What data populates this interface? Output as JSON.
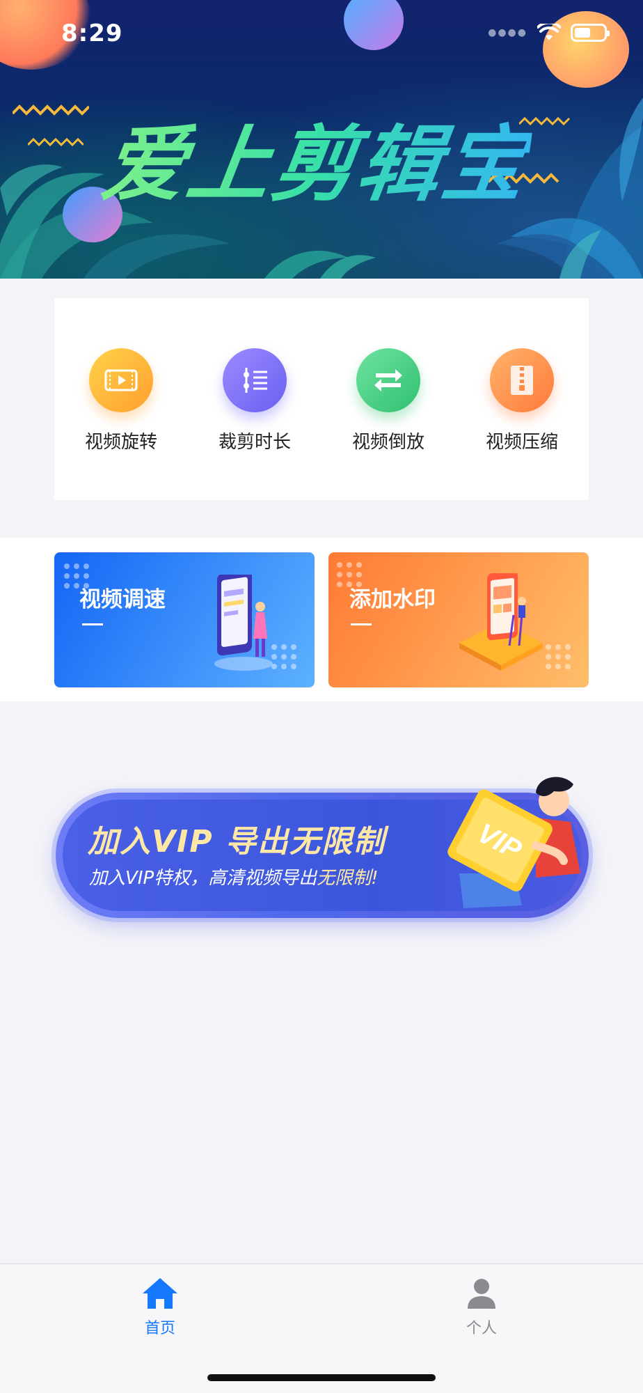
{
  "status_bar": {
    "time": "8:29",
    "battery_level": 0.55
  },
  "hero": {
    "title": "爱上剪辑宝"
  },
  "tools": [
    {
      "label": "视频旋转",
      "icon": "video-rotate-icon",
      "color_from": "#ffd24a",
      "color_to": "#ff9f2e"
    },
    {
      "label": "裁剪时长",
      "icon": "trim-duration-icon",
      "color_from": "#9b8cff",
      "color_to": "#6a5ef0"
    },
    {
      "label": "视频倒放",
      "icon": "video-reverse-icon",
      "color_from": "#6fe3a0",
      "color_to": "#2fc070"
    },
    {
      "label": "视频压缩",
      "icon": "video-compress-icon",
      "color_from": "#ffb36a",
      "color_to": "#ff7a3a"
    }
  ],
  "features": {
    "speed": {
      "label": "视频调速",
      "color_from": "#1466f5",
      "color_to": "#5db1ff"
    },
    "watermark": {
      "label": "添加水印",
      "color_from": "#ff7a34",
      "color_to": "#ffbe6a"
    }
  },
  "vip_banner": {
    "title": "加入VIP  导出无限制",
    "subtitle_prefix": "加入VIP特权，高清视频导出",
    "subtitle_highlight": "无限制!",
    "badge": "VIP"
  },
  "tabbar": {
    "home": {
      "label": "首页",
      "active_color": "#1677ff"
    },
    "profile": {
      "label": "个人",
      "color": "#8a8a8f"
    }
  }
}
